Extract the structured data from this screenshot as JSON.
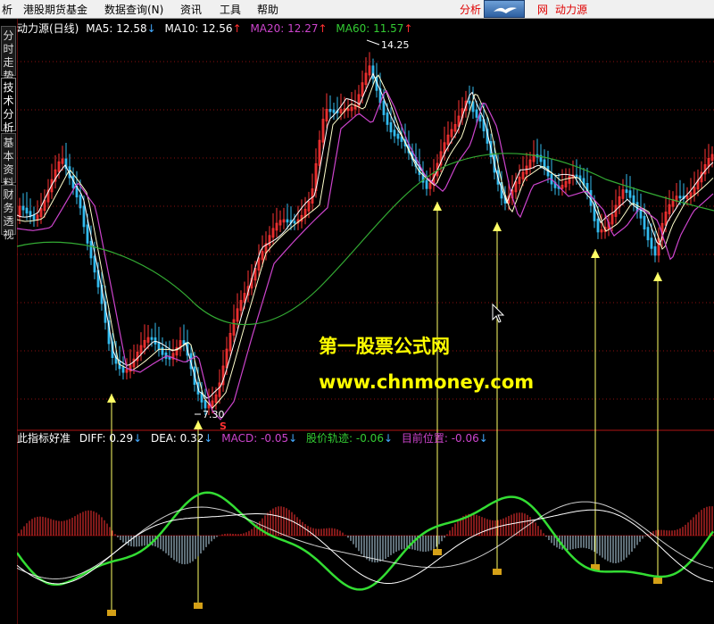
{
  "menubar": {
    "items": [
      "析",
      "港股期货基金",
      "数据查询(N)",
      "资讯",
      "工具",
      "帮助"
    ],
    "right_left": "分析",
    "right_mid": "网",
    "right_title": "动力源"
  },
  "sidebar": {
    "tabs": [
      "分时走势",
      "技术分析",
      "基本资料",
      "财务透视"
    ],
    "active": "技术分析"
  },
  "main_panel": {
    "title": "动力源(日线)",
    "indicators": [
      {
        "label": "MA5: 12.58",
        "arrow": "↓",
        "color": "#ffffff",
        "arrow_color": "#44aaff"
      },
      {
        "label": "MA10: 12.56",
        "arrow": "↑",
        "color": "#ffffff",
        "arrow_color": "#ff3030"
      },
      {
        "label": "MA20: 12.27",
        "arrow": "↑",
        "color": "#cc44cc",
        "arrow_color": "#ff3030"
      },
      {
        "label": "MA60: 11.57",
        "arrow": "↑",
        "color": "#33cc33",
        "arrow_color": "#ff3030"
      }
    ],
    "high_label": "14.25",
    "low_label": "7.30",
    "signal_mark": "S"
  },
  "sub_panel": {
    "title": "此指标好准",
    "indicators": [
      {
        "label": "DIFF: 0.29",
        "arrow": "↓",
        "color": "#ffffff",
        "arrow_color": "#44aaff"
      },
      {
        "label": "DEA: 0.32",
        "arrow": "↓",
        "color": "#ffffff",
        "arrow_color": "#44aaff"
      },
      {
        "label": "MACD: -0.05",
        "arrow": "↓",
        "color": "#cc44cc",
        "arrow_color": "#44aaff"
      },
      {
        "label": "股价轨迹: -0.06",
        "arrow": "↓",
        "color": "#33cc33",
        "arrow_color": "#44aaff"
      },
      {
        "label": "目前位置: -0.06",
        "arrow": "↓",
        "color": "#cc44cc",
        "arrow_color": "#44aaff"
      }
    ]
  },
  "watermark": {
    "line1": "第一股票公式网",
    "line2": "www.chnmoney.com"
  },
  "colors": {
    "bg": "#000000",
    "up": "#ff3333",
    "down": "#33bbee",
    "ma5": "#ffffff",
    "ma10": "#ffffcc",
    "ma20": "#cc44cc",
    "ma60": "#33aa33",
    "track": "#33dd33",
    "grid": "#8b1010",
    "signal": "#ffff66"
  }
}
